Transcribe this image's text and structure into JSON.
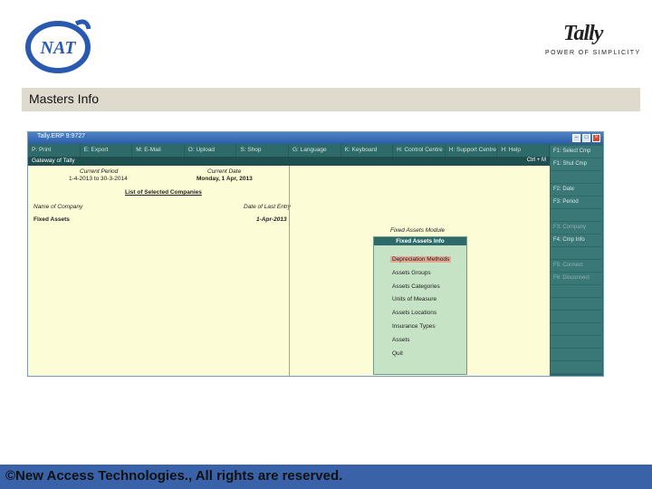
{
  "logos": {
    "nat_text": "NAT",
    "tally_text": "Tally",
    "tally_tagline": "POWER OF SIMPLICITY"
  },
  "slide": {
    "title": "Masters Info",
    "footer": "©New Access Technologies., All rights are reserved."
  },
  "tally": {
    "window_title": "Tally.ERP 9:9727",
    "menu": [
      "P: Print",
      "E: Export",
      "M: E-Mail",
      "O: Upload",
      "S: Shop",
      "G: Language",
      "K: Keyboard",
      "H: Control Centre",
      "H: Support Centre",
      "H: Help"
    ],
    "gateway_title": "Gateway of Tally",
    "header_right": "Ctrl + M",
    "current_period_label": "Current Period",
    "current_period_value": "1-4-2013 to 30-3-2014",
    "current_date_label": "Current Date",
    "current_date_value": "Monday, 1 Apr, 2013",
    "companies_title": "List of Selected Companies",
    "col_company": "Name of Company",
    "col_last_entry": "Date of Last Entry",
    "company_name": "Fixed Assets",
    "company_date": "1-Apr-2013",
    "module_caption": "Fixed Assets Module",
    "submenu_title": "Fixed Assets Info",
    "submenu_items": [
      "Depreciation Methods",
      "Assets Groups",
      "Assets Categories",
      "Units of Measure",
      "Assets Locations",
      "Insurance Types",
      "Assets",
      "Quit"
    ],
    "right_buttons": [
      "F1: Select Cmp",
      "F1: Shut Cmp",
      "",
      "F2: Date",
      "F3: Period",
      "",
      "F3: Company",
      "F4: Cmp Info",
      "",
      "F5: Connect",
      "F6: Disconnect"
    ]
  },
  "colors": {
    "footer_bg": "#3a62a8",
    "title_bar_bg": "#dedbce",
    "tally_bg": "#fcfcd6",
    "tally_teal": "#2f6a6a",
    "submenu_bg": "#c6e3c6",
    "selected_item": "#e7a793"
  }
}
